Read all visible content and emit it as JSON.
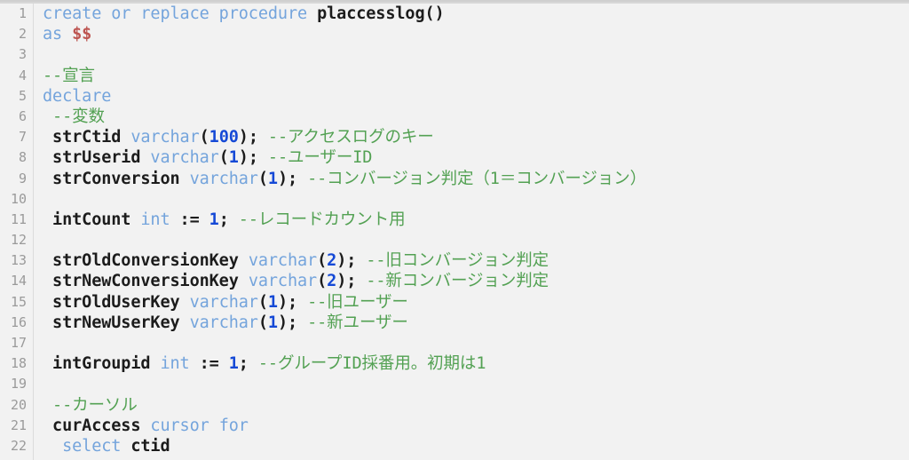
{
  "app": {
    "type": "code-editor",
    "language": "plpgsql",
    "theme_background": "#f2f2f2",
    "gutter_background": "#f2f2f2"
  },
  "colors": {
    "keyword": "#74a4dc",
    "comment": "#53a153",
    "number": "#1549d6",
    "string": "#bd5450",
    "identifier": "#1c1c1c",
    "line_number": "#9a9a9a",
    "background": "#f2f2f2",
    "gutter_border": "#dcdcdc"
  },
  "editor": {
    "first_visible_line": 1,
    "last_visible_line": 22,
    "lines": [
      {
        "n": "1",
        "tokens": [
          {
            "t": "create or replace procedure ",
            "c": "kw"
          },
          {
            "t": "placcesslog()",
            "c": "plain"
          }
        ]
      },
      {
        "n": "2",
        "tokens": [
          {
            "t": "as ",
            "c": "kw"
          },
          {
            "t": "$$",
            "c": "str"
          }
        ]
      },
      {
        "n": "3",
        "tokens": []
      },
      {
        "n": "4",
        "tokens": [
          {
            "t": "--宣言",
            "c": "com"
          }
        ]
      },
      {
        "n": "5",
        "tokens": [
          {
            "t": "declare",
            "c": "kw"
          }
        ]
      },
      {
        "n": "6",
        "tokens": [
          {
            "t": " ",
            "c": "plain"
          },
          {
            "t": "--変数",
            "c": "com"
          }
        ]
      },
      {
        "n": "7",
        "tokens": [
          {
            "t": " strCtid ",
            "c": "plain"
          },
          {
            "t": "varchar",
            "c": "kw"
          },
          {
            "t": "(",
            "c": "punc"
          },
          {
            "t": "100",
            "c": "num"
          },
          {
            "t": "); ",
            "c": "punc"
          },
          {
            "t": "--アクセスログのキー",
            "c": "com"
          }
        ]
      },
      {
        "n": "8",
        "tokens": [
          {
            "t": " strUserid ",
            "c": "plain"
          },
          {
            "t": "varchar",
            "c": "kw"
          },
          {
            "t": "(",
            "c": "punc"
          },
          {
            "t": "1",
            "c": "num"
          },
          {
            "t": "); ",
            "c": "punc"
          },
          {
            "t": "--ユーザーID",
            "c": "com"
          }
        ]
      },
      {
        "n": "9",
        "tokens": [
          {
            "t": " strConversion ",
            "c": "plain"
          },
          {
            "t": "varchar",
            "c": "kw"
          },
          {
            "t": "(",
            "c": "punc"
          },
          {
            "t": "1",
            "c": "num"
          },
          {
            "t": "); ",
            "c": "punc"
          },
          {
            "t": "--コンバージョン判定（1＝コンバージョン）",
            "c": "com"
          }
        ]
      },
      {
        "n": "10",
        "tokens": []
      },
      {
        "n": "11",
        "tokens": [
          {
            "t": " intCount ",
            "c": "plain"
          },
          {
            "t": "int",
            "c": "kw"
          },
          {
            "t": " := ",
            "c": "punc"
          },
          {
            "t": "1",
            "c": "num"
          },
          {
            "t": "; ",
            "c": "punc"
          },
          {
            "t": "--レコードカウント用",
            "c": "com"
          }
        ]
      },
      {
        "n": "12",
        "tokens": []
      },
      {
        "n": "13",
        "tokens": [
          {
            "t": " strOldConversionKey ",
            "c": "plain"
          },
          {
            "t": "varchar",
            "c": "kw"
          },
          {
            "t": "(",
            "c": "punc"
          },
          {
            "t": "2",
            "c": "num"
          },
          {
            "t": "); ",
            "c": "punc"
          },
          {
            "t": "--旧コンバージョン判定",
            "c": "com"
          }
        ]
      },
      {
        "n": "14",
        "tokens": [
          {
            "t": " strNewConversionKey ",
            "c": "plain"
          },
          {
            "t": "varchar",
            "c": "kw"
          },
          {
            "t": "(",
            "c": "punc"
          },
          {
            "t": "2",
            "c": "num"
          },
          {
            "t": "); ",
            "c": "punc"
          },
          {
            "t": "--新コンバージョン判定",
            "c": "com"
          }
        ]
      },
      {
        "n": "15",
        "tokens": [
          {
            "t": " strOldUserKey ",
            "c": "plain"
          },
          {
            "t": "varchar",
            "c": "kw"
          },
          {
            "t": "(",
            "c": "punc"
          },
          {
            "t": "1",
            "c": "num"
          },
          {
            "t": "); ",
            "c": "punc"
          },
          {
            "t": "--旧ユーザー",
            "c": "com"
          }
        ]
      },
      {
        "n": "16",
        "tokens": [
          {
            "t": " strNewUserKey ",
            "c": "plain"
          },
          {
            "t": "varchar",
            "c": "kw"
          },
          {
            "t": "(",
            "c": "punc"
          },
          {
            "t": "1",
            "c": "num"
          },
          {
            "t": "); ",
            "c": "punc"
          },
          {
            "t": "--新ユーザー",
            "c": "com"
          }
        ]
      },
      {
        "n": "17",
        "tokens": []
      },
      {
        "n": "18",
        "tokens": [
          {
            "t": " intGroupid ",
            "c": "plain"
          },
          {
            "t": "int",
            "c": "kw"
          },
          {
            "t": " := ",
            "c": "punc"
          },
          {
            "t": "1",
            "c": "num"
          },
          {
            "t": "; ",
            "c": "punc"
          },
          {
            "t": "--グループID採番用。初期は1",
            "c": "com"
          }
        ]
      },
      {
        "n": "19",
        "tokens": []
      },
      {
        "n": "20",
        "tokens": [
          {
            "t": " ",
            "c": "plain"
          },
          {
            "t": "--カーソル",
            "c": "com"
          }
        ]
      },
      {
        "n": "21",
        "tokens": [
          {
            "t": " curAccess ",
            "c": "plain"
          },
          {
            "t": "cursor for",
            "c": "kw"
          }
        ]
      },
      {
        "n": "22",
        "tokens": [
          {
            "t": "  ",
            "c": "plain"
          },
          {
            "t": "select ",
            "c": "kw"
          },
          {
            "t": "ctid",
            "c": "plain"
          }
        ]
      }
    ]
  }
}
